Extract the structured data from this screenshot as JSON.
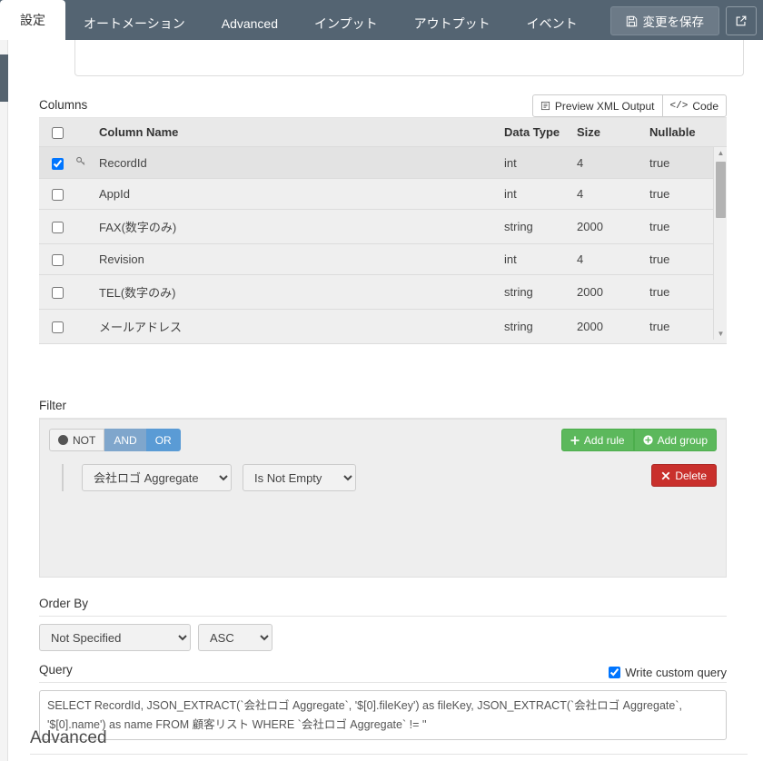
{
  "topbar": {
    "tabs": [
      {
        "label": "設定",
        "active": true
      },
      {
        "label": "オートメーション",
        "active": false
      },
      {
        "label": "Advanced",
        "active": false
      },
      {
        "label": "インプット",
        "active": false
      },
      {
        "label": "アウトプット",
        "active": false
      },
      {
        "label": "イベント",
        "active": false
      }
    ],
    "save_label": "変更を保存",
    "save_icon": "floppy-disk-icon",
    "external_icon": "external-link-icon",
    "accent_color": "#546472"
  },
  "columns": {
    "label": "Columns",
    "preview_label": "Preview XML Output",
    "preview_icon": "xml-preview-icon",
    "code_label": "Code",
    "code_icon": "code-icon",
    "headers": [
      "",
      "",
      "Column Name",
      "Data Type",
      "Size",
      "Nullable"
    ],
    "rows": [
      {
        "checked": true,
        "key": true,
        "name": "RecordId",
        "type": "int",
        "size": "4",
        "nullable": "true"
      },
      {
        "checked": false,
        "key": false,
        "name": "AppId",
        "type": "int",
        "size": "4",
        "nullable": "true"
      },
      {
        "checked": false,
        "key": false,
        "name": "FAX(数字のみ)",
        "type": "string",
        "size": "2000",
        "nullable": "true"
      },
      {
        "checked": false,
        "key": false,
        "name": "Revision",
        "type": "int",
        "size": "4",
        "nullable": "true"
      },
      {
        "checked": false,
        "key": false,
        "name": "TEL(数字のみ)",
        "type": "string",
        "size": "2000",
        "nullable": "true"
      },
      {
        "checked": false,
        "key": false,
        "name": "メールアドレス",
        "type": "string",
        "size": "2000",
        "nullable": "true"
      }
    ]
  },
  "filter": {
    "label": "Filter",
    "not_label": "NOT",
    "and_label": "AND",
    "or_label": "OR",
    "and_active": true,
    "or_active": false,
    "add_rule_label": "Add rule",
    "add_group_label": "Add group",
    "delete_label": "Delete",
    "rule": {
      "field_value": "会社ロゴ Aggregate",
      "operator_value": "Is Not Empty"
    },
    "add_color": "#5cb85c",
    "delete_color": "#c9302c",
    "cond_color": "#5a9bd5"
  },
  "order_by": {
    "label": "Order By",
    "field_value": "Not Specified",
    "direction_value": "ASC"
  },
  "query": {
    "label": "Query",
    "custom_label": "Write custom query",
    "custom_checked": true,
    "sql": "SELECT RecordId, JSON_EXTRACT(`会社ロゴ Aggregate`, '$[0].fileKey') as fileKey, JSON_EXTRACT(`会社ロゴ Aggregate`, '$[0].name') as name FROM 顧客リスト WHERE `会社ロゴ Aggregate` != ''"
  },
  "advanced": {
    "title": "Advanced"
  }
}
